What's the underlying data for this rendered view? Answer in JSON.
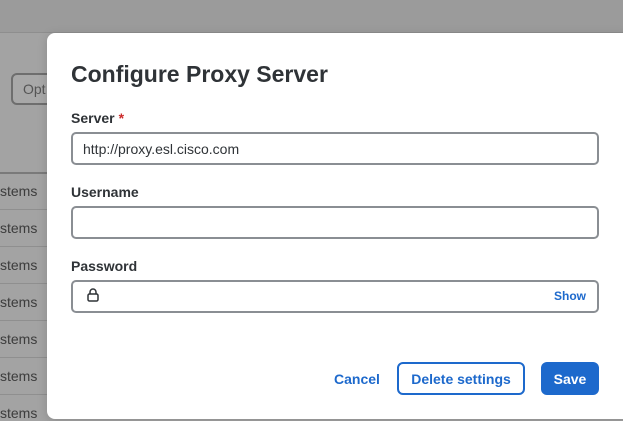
{
  "background": {
    "option_button_label": "Opt",
    "table_rows": [
      "stems",
      "stems",
      "stems",
      "stems",
      "stems",
      "stems",
      "stems"
    ]
  },
  "modal": {
    "title": "Configure Proxy Server",
    "server": {
      "label": "Server",
      "required_mark": "*",
      "value": "http://proxy.esl.cisco.com"
    },
    "username": {
      "label": "Username",
      "value": ""
    },
    "password": {
      "label": "Password",
      "value": "",
      "toggle_label": "Show",
      "icon": "lock-icon"
    },
    "buttons": {
      "cancel": "Cancel",
      "delete": "Delete settings",
      "save": "Save"
    }
  },
  "colors": {
    "accent": "#1d69cc",
    "required": "#cc2a2a",
    "text": "#2f3337"
  }
}
